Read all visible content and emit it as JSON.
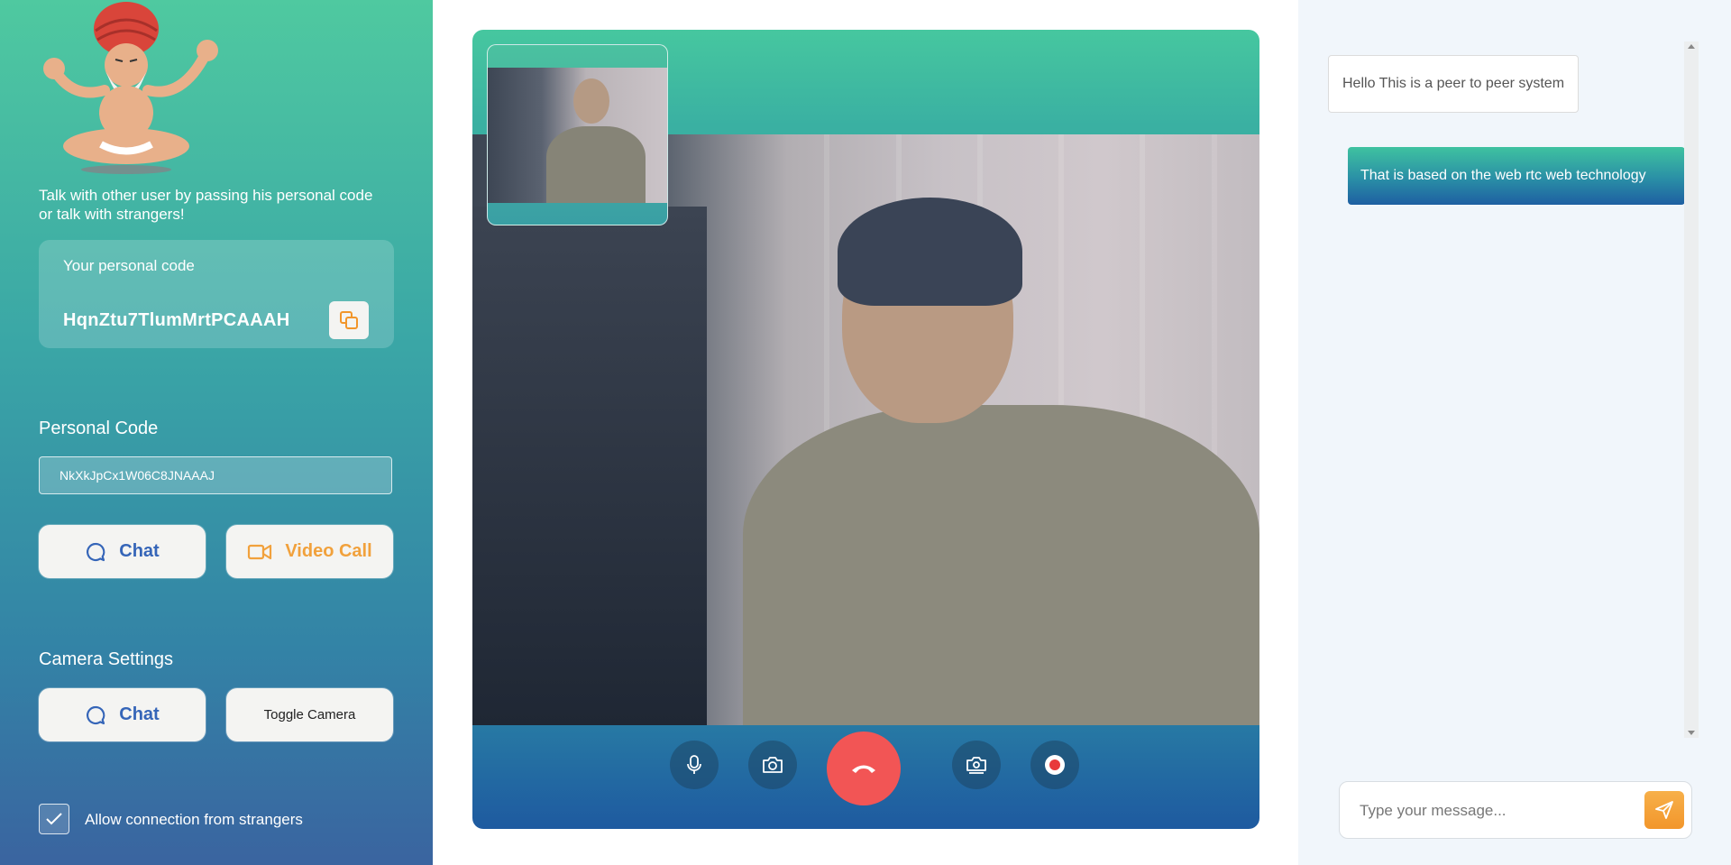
{
  "sidebar": {
    "tagline": "Talk with other user by passing his personal code or talk with strangers!",
    "personal_code_label": "Your personal code",
    "personal_code_value": "HqnZtu7TlumMrtPCAAAH",
    "copy_icon": "copy-icon",
    "personal_code_section_title": "Personal Code",
    "personal_code_input_value": "NkXkJpCx1W06C8JNAAAJ",
    "chat_button_label": "Chat",
    "video_call_button_label": "Video Call",
    "camera_settings_title": "Camera Settings",
    "camera_chat_button_label": "Chat",
    "toggle_camera_button_label": "Toggle Camera",
    "allow_strangers_label": "Allow connection from strangers",
    "allow_strangers_checked": true
  },
  "video": {
    "controls": [
      {
        "name": "microphone-icon"
      },
      {
        "name": "camera-icon"
      },
      {
        "name": "hang-up-icon"
      },
      {
        "name": "switch-camera-icon"
      },
      {
        "name": "record-icon"
      }
    ]
  },
  "chat": {
    "messages": [
      {
        "direction": "incoming",
        "text": "Hello This is a peer to peer system"
      },
      {
        "direction": "outgoing",
        "text": "That is based on the web rtc web technology"
      }
    ],
    "input_placeholder": "Type your message...",
    "send_icon": "send-icon"
  },
  "colors": {
    "accent_green": "#4fc9a0",
    "accent_blue": "#3565b8",
    "accent_orange": "#f1a13c",
    "hangup_red": "#f25555"
  }
}
